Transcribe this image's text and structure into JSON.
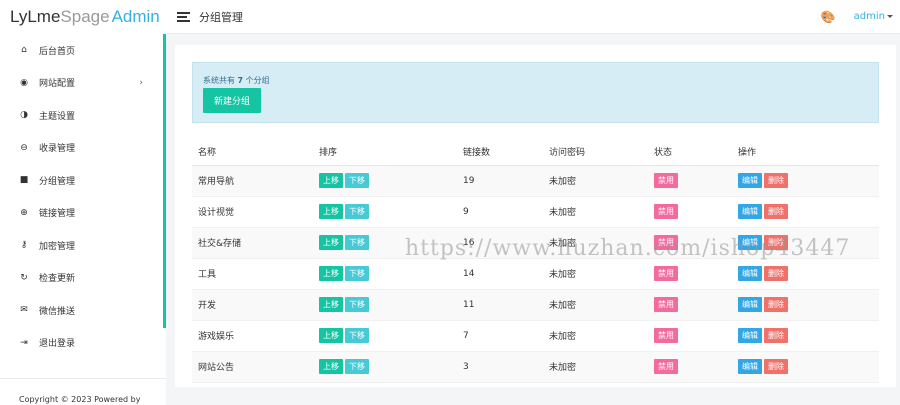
{
  "brand": {
    "part1": "LyLme",
    "part2": "Spage",
    "part3": "Admin"
  },
  "topbar": {
    "title": "分组管理",
    "user": "admin"
  },
  "sidebar": {
    "items": [
      {
        "label": "后台首页",
        "icon": "home-icon",
        "glyph": "⌂"
      },
      {
        "label": "网站配置",
        "icon": "palette-icon",
        "glyph": "◉",
        "arrow": "›"
      },
      {
        "label": "主题设置",
        "icon": "contrast-icon",
        "glyph": "◑"
      },
      {
        "label": "收录管理",
        "icon": "link-icon",
        "glyph": "⊖"
      },
      {
        "label": "分组管理",
        "icon": "folder-icon",
        "glyph": "■"
      },
      {
        "label": "链接管理",
        "icon": "globe-icon",
        "glyph": "⊕"
      },
      {
        "label": "加密管理",
        "icon": "key-icon",
        "glyph": "⚷"
      },
      {
        "label": "检查更新",
        "icon": "refresh-icon",
        "glyph": "↻"
      },
      {
        "label": "微信推送",
        "icon": "wechat-icon",
        "glyph": "✉"
      },
      {
        "label": "退出登录",
        "icon": "logout-icon",
        "glyph": "⇥"
      }
    ],
    "copyright": "Copyright © 2023 Powered by"
  },
  "alert": {
    "prefix": "系统共有 ",
    "count": "7",
    "suffix": " 个分组",
    "new_button": "新建分组"
  },
  "table": {
    "headers": [
      "名称",
      "排序",
      "链接数",
      "访问密码",
      "状态",
      "操作"
    ],
    "buttons": {
      "up": "上移",
      "down": "下移",
      "ban": "禁用",
      "edit": "编辑",
      "delete": "删除"
    },
    "rows": [
      {
        "name": "常用导航",
        "count": "19",
        "password": "未加密"
      },
      {
        "name": "设计视觉",
        "count": "9",
        "password": "未加密"
      },
      {
        "name": "社交&存储",
        "count": "16",
        "password": "未加密"
      },
      {
        "name": "工具",
        "count": "14",
        "password": "未加密"
      },
      {
        "name": "开发",
        "count": "11",
        "password": "未加密"
      },
      {
        "name": "游戏娱乐",
        "count": "7",
        "password": "未加密"
      },
      {
        "name": "网站公告",
        "count": "3",
        "password": "未加密"
      }
    ]
  },
  "watermark": "https://www.huzhan.com/ishop43447",
  "colors": {
    "accent": "#15c4a3",
    "brand_blue": "#33b1e6",
    "danger": "#f0706a",
    "pink": "#f36a9e"
  }
}
